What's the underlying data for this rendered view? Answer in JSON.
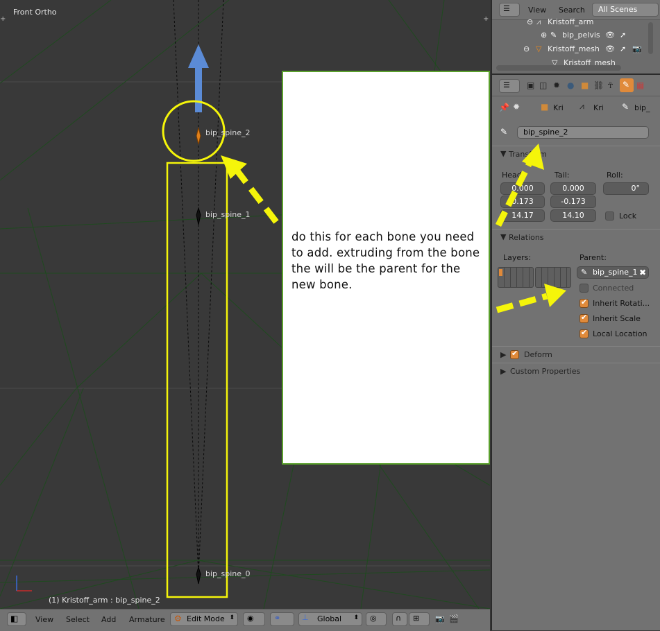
{
  "viewport": {
    "view_name": "Front Ortho",
    "status": "(1) Kristoff_arm : bip_spine_2",
    "bones": [
      "bip_spine_2",
      "bip_spine_1",
      "bip_spine_0"
    ]
  },
  "note": {
    "text": "do this for each bone you need to add. extruding from the bone the will be the parent for the new bone."
  },
  "bottom_bar": {
    "menus": [
      "View",
      "Select",
      "Add",
      "Armature"
    ],
    "mode": "Edit Mode",
    "orientation": "Global"
  },
  "outliner": {
    "menus": [
      "View",
      "Search"
    ],
    "scene_filter": "All Scenes",
    "items": [
      "Kristoff_arm",
      "bip_pelvis",
      "Kristoff_mesh",
      "Kristoff_mesh"
    ]
  },
  "properties": {
    "breadcrumb": [
      "Kri",
      "Kri",
      "bip_"
    ],
    "bone_name": "bip_spine_2",
    "transform": {
      "title": "Transform",
      "head_label": "Head:",
      "tail_label": "Tail:",
      "roll_label": "Roll:",
      "head": [
        "0.000",
        "0.173",
        "14.17"
      ],
      "tail": [
        "0.000",
        "-0.173",
        "14.10"
      ],
      "roll": "0°",
      "lock_label": "Lock"
    },
    "relations": {
      "title": "Relations",
      "layers_label": "Layers:",
      "parent_label": "Parent:",
      "parent": "bip_spine_1",
      "connected": "Connected",
      "inherit_rotation": "Inherit Rotati...",
      "inherit_scale": "Inherit Scale",
      "local_location": "Local Location"
    },
    "deform": "Deform",
    "custom_properties": "Custom Properties"
  },
  "colors": {
    "accent_yellow": "#f5f50a",
    "arrow_blue": "#5b8bd6",
    "note_border": "#5aa02c",
    "checkbox_orange": "#e08a3a"
  }
}
